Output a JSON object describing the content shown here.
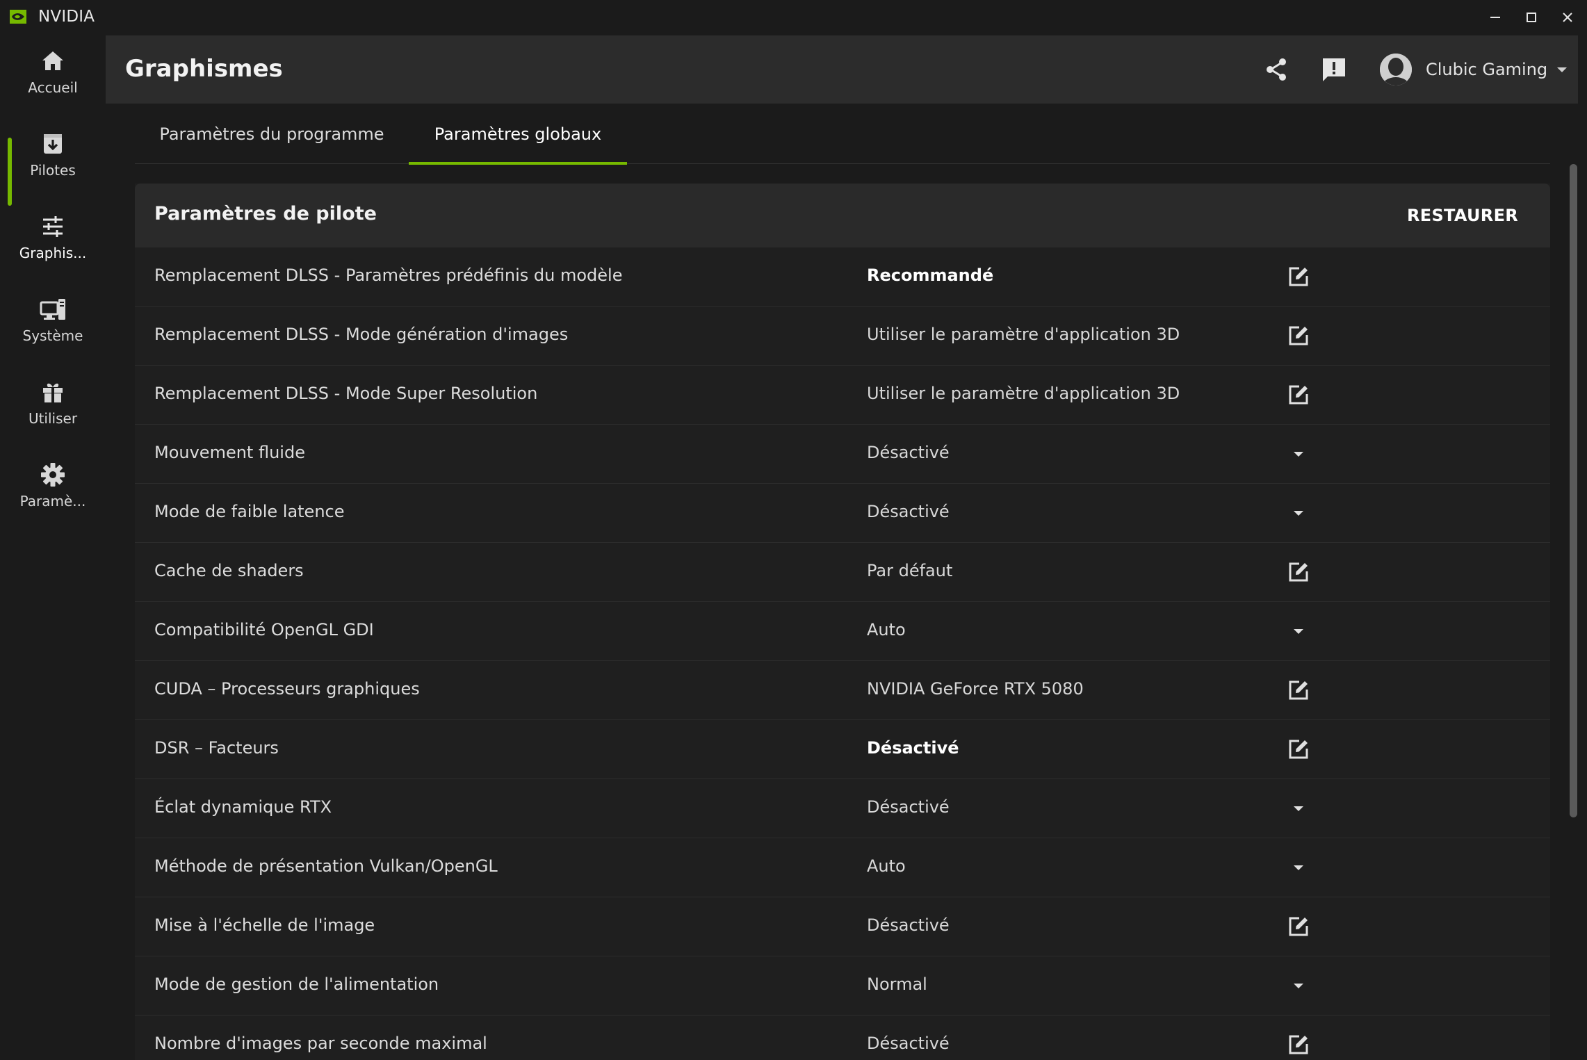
{
  "window": {
    "app_name": "NVIDIA",
    "controls": {
      "minimize": "minimize-icon",
      "maximize": "maximize-icon",
      "close": "close-icon"
    }
  },
  "colors": {
    "accent": "#76b900",
    "background": "#1b1b1b",
    "header": "#2c2c2c",
    "panel_header": "#2a2a2a"
  },
  "sidebar": {
    "items": [
      {
        "label": "Accueil",
        "icon": "home-icon",
        "active": false
      },
      {
        "label": "Pilotes",
        "icon": "driver-download-icon",
        "active": false
      },
      {
        "label": "Graphis...",
        "icon": "sliders-icon",
        "active": true
      },
      {
        "label": "Système",
        "icon": "system-monitor-icon",
        "active": false
      },
      {
        "label": "Utiliser",
        "icon": "gift-icon",
        "active": false
      },
      {
        "label": "Paramè...",
        "icon": "gear-icon",
        "active": false
      }
    ]
  },
  "header": {
    "title": "Graphismes",
    "share_icon": "share-icon",
    "feedback_icon": "feedback-icon",
    "user_name": "Clubic Gaming"
  },
  "tabs": [
    {
      "label": "Paramètres du programme",
      "active": false
    },
    {
      "label": "Paramètres globaux",
      "active": true
    }
  ],
  "panel": {
    "title": "Paramètres de pilote",
    "restore_label": "RESTAURER",
    "rows": [
      {
        "name": "Remplacement DLSS - Paramètres prédéfinis du modèle",
        "value": "Recommandé",
        "bold": true,
        "control": "edit"
      },
      {
        "name": "Remplacement DLSS - Mode génération d'images",
        "value": "Utiliser le paramètre d'application 3D",
        "bold": false,
        "control": "edit"
      },
      {
        "name": "Remplacement DLSS - Mode Super Resolution",
        "value": "Utiliser le paramètre d'application 3D",
        "bold": false,
        "control": "edit"
      },
      {
        "name": "Mouvement fluide",
        "value": "Désactivé",
        "bold": false,
        "control": "dropdown"
      },
      {
        "name": "Mode de faible latence",
        "value": "Désactivé",
        "bold": false,
        "control": "dropdown"
      },
      {
        "name": "Cache de shaders",
        "value": "Par défaut",
        "bold": false,
        "control": "edit"
      },
      {
        "name": "Compatibilité OpenGL GDI",
        "value": "Auto",
        "bold": false,
        "control": "dropdown"
      },
      {
        "name": "CUDA – Processeurs graphiques",
        "value": "NVIDIA GeForce RTX 5080",
        "bold": false,
        "control": "edit"
      },
      {
        "name": "DSR – Facteurs",
        "value": "Désactivé",
        "bold": true,
        "control": "edit"
      },
      {
        "name": "Éclat dynamique RTX",
        "value": "Désactivé",
        "bold": false,
        "control": "dropdown"
      },
      {
        "name": "Méthode de présentation Vulkan/OpenGL",
        "value": "Auto",
        "bold": false,
        "control": "dropdown"
      },
      {
        "name": "Mise à l'échelle de l'image",
        "value": "Désactivé",
        "bold": false,
        "control": "edit"
      },
      {
        "name": "Mode de gestion de l'alimentation",
        "value": "Normal",
        "bold": false,
        "control": "dropdown"
      },
      {
        "name": "Nombre d'images par seconde maximal",
        "value": "Désactivé",
        "bold": false,
        "control": "edit"
      }
    ]
  }
}
